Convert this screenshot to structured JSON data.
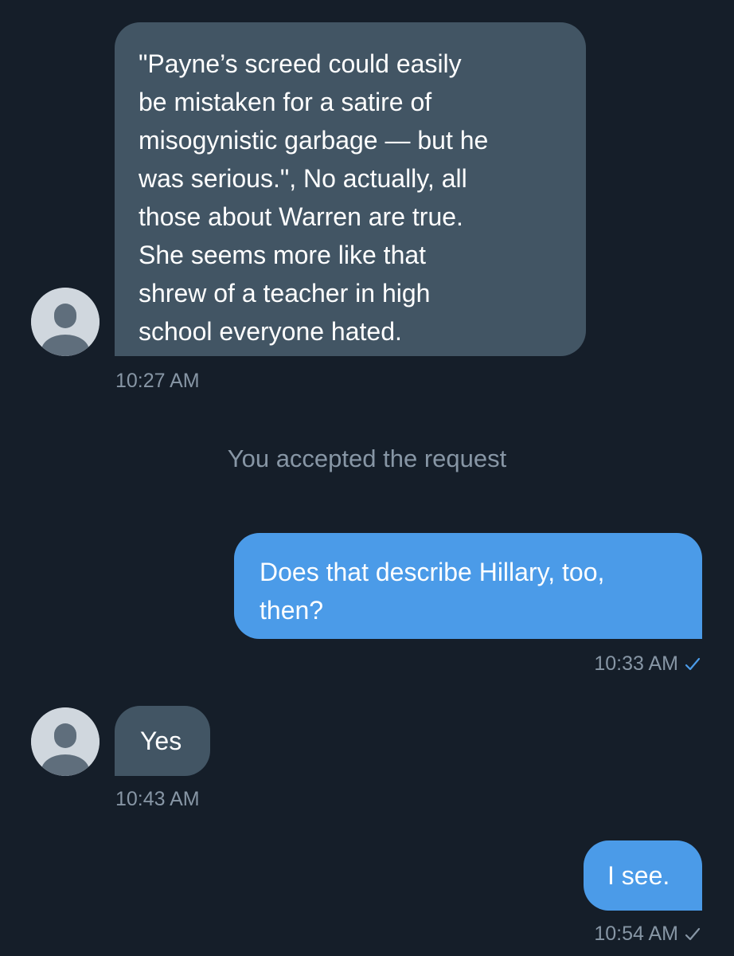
{
  "conversation": {
    "messages": [
      {
        "direction": "incoming",
        "text": "\"Payne’s screed could easily\nbe mistaken for a satire of\nmisogynistic garbage — but he\nwas serious.\", No actually, all\nthose about Warren are true.\nShe seems more like that\nshrew of a teacher in high\nschool everyone hated.",
        "time": "10:27 AM"
      },
      {
        "direction": "outgoing",
        "text": "Does that describe Hillary, too,\nthen?",
        "time": "10:33 AM",
        "receipt": "read"
      },
      {
        "direction": "incoming",
        "text": "Yes",
        "time": "10:43 AM"
      },
      {
        "direction": "outgoing",
        "text": "I see.",
        "time": "10:54 AM",
        "receipt": "sent"
      }
    ],
    "system_note": "You accepted the request"
  },
  "theme": {
    "background": "#151e29",
    "incoming_bubble": "#425564",
    "outgoing_bubble": "#4b9be8",
    "timestamp_color": "#8796a5",
    "read_check_color": "#4b9be8",
    "sent_check_color": "#8796a5"
  },
  "icons": {
    "avatar": "default-avatar-icon",
    "read_receipt": "checkmark-icon",
    "sent_receipt": "checkmark-icon"
  }
}
